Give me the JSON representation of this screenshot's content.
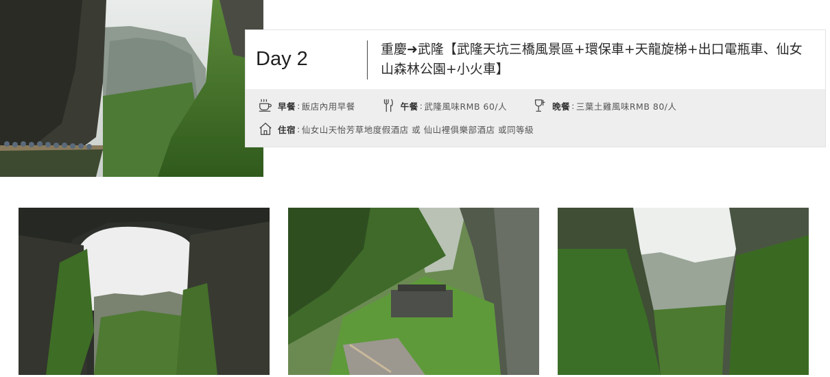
{
  "itinerary": {
    "day_label": "Day 2",
    "route_title": "重慶➜武隆【武隆天坑三橋風景區+環保車+天龍旋梯+出口電瓶車、仙女山森林公園+小火車】",
    "meals": [
      {
        "icon": "coffee-cup-icon",
        "label": "早餐",
        "value": "飯店內用早餐"
      },
      {
        "icon": "fork-knife-icon",
        "label": "午餐",
        "value": "武隆風味RMB 60/人"
      },
      {
        "icon": "wine-glass-icon",
        "label": "晚餐",
        "value": "三葉土雞風味RMB 80/人"
      }
    ],
    "stay": {
      "icon": "house-icon",
      "label": "住宿",
      "value": "仙女山天怡芳草地度假酒店 或 仙山裡俱樂部酒店 或同等級"
    },
    "separator": ":"
  }
}
